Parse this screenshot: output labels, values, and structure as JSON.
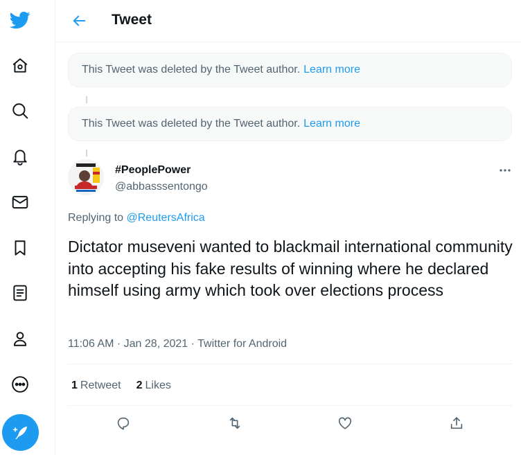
{
  "header": {
    "title": "Tweet"
  },
  "nav": {
    "icons": [
      "twitter-logo",
      "home-icon",
      "explore-icon",
      "notifications-icon",
      "messages-icon",
      "bookmarks-icon",
      "lists-icon",
      "profile-icon",
      "more-icon",
      "compose-icon"
    ],
    "accent": "#1d9bf0"
  },
  "deleted_notices": [
    {
      "text": "This Tweet was deleted by the Tweet author.",
      "link": "Learn more"
    },
    {
      "text": "This Tweet was deleted by the Tweet author.",
      "link": "Learn more"
    }
  ],
  "tweet": {
    "display_name": "#PeoplePower",
    "handle": "@abbasssentongo",
    "replying_prefix": "Replying to",
    "replying_to": "@ReutersAfrica",
    "text": "Dictator museveni wanted to blackmail international community into accepting his fake results of winning where he declared himself using army which took over elections process",
    "time": "11:06 AM",
    "date": "Jan 28, 2021",
    "source": "Twitter for Android",
    "separator": "·",
    "retweets": {
      "count": "1",
      "label": "Retweet"
    },
    "likes": {
      "count": "2",
      "label": "Likes"
    }
  },
  "actions": [
    "reply-icon",
    "retweet-icon",
    "like-icon",
    "share-icon"
  ]
}
